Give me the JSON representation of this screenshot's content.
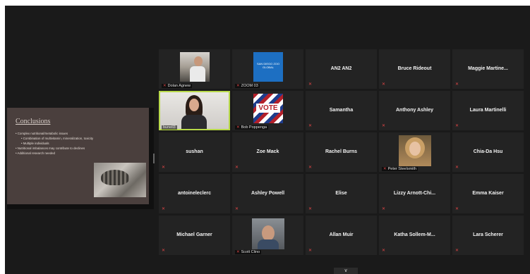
{
  "slide": {
    "title": "Conclusions",
    "bullets": [
      {
        "text": "Complex nutritional/metabolic issues",
        "sub": false
      },
      {
        "text": "Combination of multivitamin, mineralization, toxicity",
        "sub": true
      },
      {
        "text": "Multiple individuals",
        "sub": true
      },
      {
        "text": "Nutritional imbalances may contribute to declines",
        "sub": false
      },
      {
        "text": "Additional research needed",
        "sub": false
      }
    ]
  },
  "participants": [
    {
      "name": "Dolan Agnew",
      "video": true
    },
    {
      "name": "ZOOM 03",
      "video": true,
      "logo_text": "SAN DIEGO ZOO GLOBAL"
    },
    {
      "name": "AN2 AN2",
      "video": false
    },
    {
      "name": "Bruce Rideout",
      "video": false
    },
    {
      "name": "Maggie Martine...",
      "video": false
    },
    {
      "name": "bunell3",
      "video": true,
      "active": true
    },
    {
      "name": "Bob Poppenga",
      "video": true,
      "logo_text": "VOTE"
    },
    {
      "name": "Samantha",
      "video": false
    },
    {
      "name": "Anthony Ashley",
      "video": false
    },
    {
      "name": "Laura Martinelli",
      "video": false
    },
    {
      "name": "sushan",
      "video": false
    },
    {
      "name": "Zoe Mack",
      "video": false
    },
    {
      "name": "Rachel Burns",
      "video": false
    },
    {
      "name": "Peter Steelsmith",
      "video": true
    },
    {
      "name": "Chia-Da Hsu",
      "video": false
    },
    {
      "name": "antoineleclerc",
      "video": false
    },
    {
      "name": "Ashley Powell",
      "video": false
    },
    {
      "name": "Elise",
      "video": false
    },
    {
      "name": "Lizzy Arnott-Chi...",
      "video": false
    },
    {
      "name": "Emma Kaiser",
      "video": false
    },
    {
      "name": "Michael Garner",
      "video": false
    },
    {
      "name": "Scott Clino",
      "video": true
    },
    {
      "name": "Allan Muir",
      "video": false
    },
    {
      "name": "Katha Sollem-M...",
      "video": false
    },
    {
      "name": "Lara Scherer",
      "video": false
    }
  ],
  "controls": {
    "collapse_icon": "chevron-down-icon"
  },
  "colors": {
    "active_speaker": "#b8d94a",
    "muted": "#e04646",
    "tile_bg": "#232323"
  }
}
